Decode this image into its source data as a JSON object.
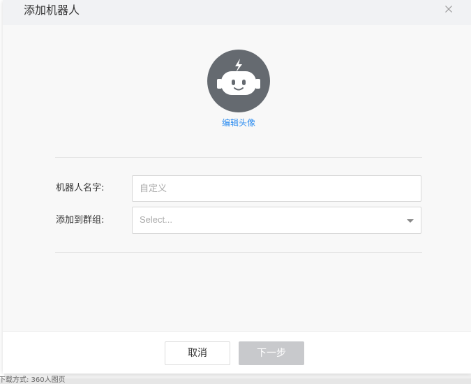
{
  "dialog": {
    "title": "添加机器人",
    "close_icon": "close-icon"
  },
  "avatar": {
    "icon": "robot-icon",
    "edit_label": "编辑头像"
  },
  "form": {
    "name_label": "机器人名字:",
    "name_value": "",
    "name_placeholder": "自定义",
    "group_label": "添加到群组:",
    "group_placeholder": "Select..."
  },
  "footer": {
    "cancel_label": "取消",
    "next_label": "下一步"
  },
  "background": {
    "bottom_text": "下载方式: 360人图页"
  },
  "colors": {
    "avatar_bg": "#656a70",
    "link": "#2f8ef0",
    "disabled_button": "#c8c9cc",
    "header_bg": "#f1f2f4"
  }
}
